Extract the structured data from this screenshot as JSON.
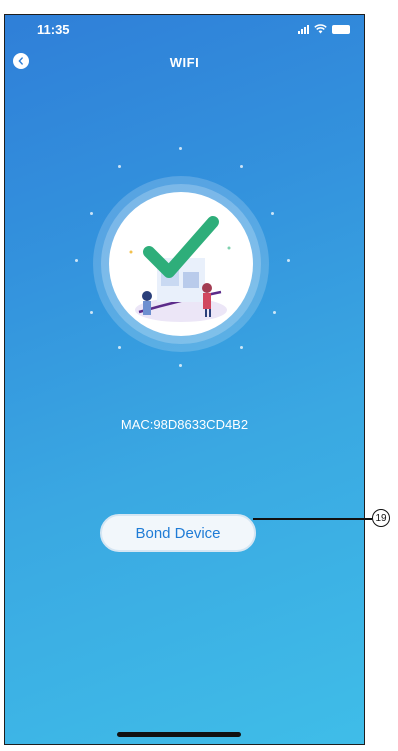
{
  "status_bar": {
    "time": "11:35"
  },
  "header": {
    "title": "WIFI",
    "back_icon": "chevron-left-icon"
  },
  "illustration": {
    "icon": "checkmark-icon",
    "accent": "#2eae7a"
  },
  "device": {
    "mac_label": "MAC:98D8633CD4B2"
  },
  "actions": {
    "bond_label": "Bond Device"
  },
  "annotation": {
    "callout_number": "19"
  },
  "colors": {
    "gradient_top": "#2f7fd8",
    "gradient_bottom": "#3fbde8",
    "button_text": "#1f7cd6"
  }
}
